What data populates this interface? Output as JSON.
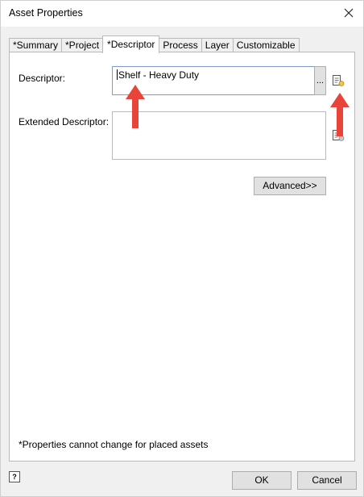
{
  "window": {
    "title": "Asset Properties"
  },
  "tabs": [
    {
      "label": "*Summary",
      "active": false
    },
    {
      "label": "*Project",
      "active": false
    },
    {
      "label": "*Descriptor",
      "active": true
    },
    {
      "label": "Process",
      "active": false
    },
    {
      "label": "Layer",
      "active": false
    },
    {
      "label": "Customizable",
      "active": false
    }
  ],
  "descriptor": {
    "label": "Descriptor:",
    "value": "Shelf - Heavy Duty",
    "browse_label": "..."
  },
  "extended_descriptor": {
    "label": "Extended Descriptor:",
    "value": ""
  },
  "advanced_label": "Advanced>>",
  "note": "*Properties cannot change for placed assets",
  "footer": {
    "help_label": "?",
    "ok_label": "OK",
    "cancel_label": "Cancel"
  },
  "colors": {
    "annotation_arrow": "#e8443a",
    "input_focus_border": "#7a9cc6"
  },
  "icons": [
    "close-icon",
    "property-lookup-icon",
    "help-icon",
    "annotation-arrow"
  ]
}
